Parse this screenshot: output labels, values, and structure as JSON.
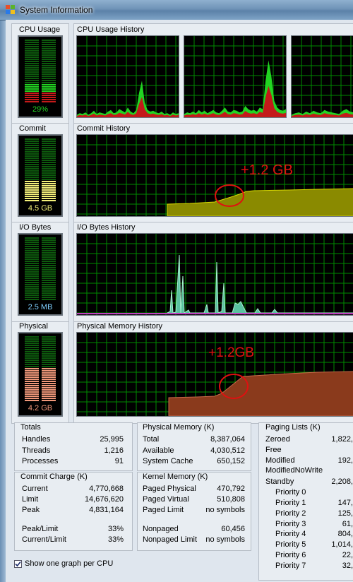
{
  "window": {
    "title": "System Information"
  },
  "cpu": {
    "label": "CPU Usage",
    "history_label": "CPU Usage History",
    "value": "29%",
    "level": 0.29,
    "history_levels": {
      "graph1": [
        3,
        5,
        4,
        6,
        3,
        5,
        8,
        4,
        6,
        5,
        4,
        7,
        9,
        5,
        6,
        10,
        8,
        6,
        12,
        7,
        5,
        9,
        30,
        45,
        18,
        9,
        7,
        8,
        6,
        5,
        7,
        4,
        5,
        3,
        6,
        4,
        5
      ],
      "graph2": [
        4,
        6,
        5,
        7,
        5,
        9,
        6,
        8,
        5,
        7,
        9,
        6,
        5,
        8,
        12,
        7,
        6,
        9,
        8,
        6,
        7,
        14,
        10,
        8,
        9,
        7,
        12,
        10,
        45,
        70,
        50,
        20,
        12,
        9,
        8,
        10
      ],
      "graph3": [
        3,
        5,
        6,
        4,
        7,
        5,
        8,
        6,
        5,
        9,
        7,
        6,
        5,
        4,
        8,
        10,
        7,
        6
      ]
    }
  },
  "commit": {
    "label": "Commit",
    "history_label": "Commit History",
    "value": "4.5 GB",
    "level": 0.33,
    "annotation": "+1.2 GB"
  },
  "io": {
    "label": "I/O Bytes",
    "history_label": "I/O Bytes History",
    "value": "2.5  MB"
  },
  "physical": {
    "label": "Physical",
    "history_label": "Physical Memory History",
    "value": "4.2 GB",
    "level": 0.5,
    "annotation": "+1.2GB"
  },
  "totals": {
    "title": "Totals",
    "rows": [
      {
        "k": "Handles",
        "v": "25,995"
      },
      {
        "k": "Threads",
        "v": "1,216"
      },
      {
        "k": "Processes",
        "v": "91"
      }
    ]
  },
  "physical_memory": {
    "title": "Physical Memory (K)",
    "rows": [
      {
        "k": "Total",
        "v": "8,387,064"
      },
      {
        "k": "Available",
        "v": "4,030,512"
      },
      {
        "k": "System Cache",
        "v": "650,152"
      }
    ]
  },
  "commit_charge": {
    "title": "Commit Charge (K)",
    "rows": [
      {
        "k": "Current",
        "v": "4,770,668"
      },
      {
        "k": "Limit",
        "v": "14,676,620"
      },
      {
        "k": "Peak",
        "v": "4,831,164"
      },
      {
        "k": "Peak/Limit",
        "v": "33%"
      },
      {
        "k": "Current/Limit",
        "v": "33%"
      }
    ]
  },
  "kernel_memory": {
    "title": "Kernel Memory (K)",
    "rows": [
      {
        "k": "Paged Physical",
        "v": "470,792"
      },
      {
        "k": "Paged Virtual",
        "v": "510,808"
      },
      {
        "k": "Paged Limit",
        "v": "no symbols"
      },
      {
        "k": "Nonpaged",
        "v": "60,456"
      },
      {
        "k": "Nonpaged Limit",
        "v": "no symbols"
      }
    ]
  },
  "paging_lists": {
    "title": "Paging Lists (K)",
    "rows": [
      {
        "k": "Zeroed",
        "v": "1,822,"
      },
      {
        "k": "Free",
        "v": ""
      },
      {
        "k": "Modified",
        "v": "192,"
      },
      {
        "k": "ModifiedNoWrite",
        "v": ""
      },
      {
        "k": "Standby",
        "v": "2,208,"
      },
      {
        "k": "Priority 0",
        "v": ""
      },
      {
        "k": "Priority 1",
        "v": "147,"
      },
      {
        "k": "Priority 2",
        "v": "125,"
      },
      {
        "k": "Priority 3",
        "v": "61,"
      },
      {
        "k": "Priority 4",
        "v": "804,"
      },
      {
        "k": "Priority 5",
        "v": "1,014,"
      },
      {
        "k": "Priority 6",
        "v": "22,"
      },
      {
        "k": "Priority 7",
        "v": "32,"
      }
    ]
  },
  "footer": {
    "checkbox_label": "Show one graph per CPU",
    "checked": true
  },
  "colors": {
    "grid": "#008a00",
    "cpu_green": "#22d422",
    "cpu_red": "#c41a1a",
    "commit_fill": "#8a8a00",
    "commit_meter": "#f4f07a",
    "io_fill": "#5ac2a0",
    "io_line": "#c040c0",
    "physical_fill": "#8a3a1c",
    "physical_meter": "#f0987a",
    "annotation": "#e01010"
  }
}
